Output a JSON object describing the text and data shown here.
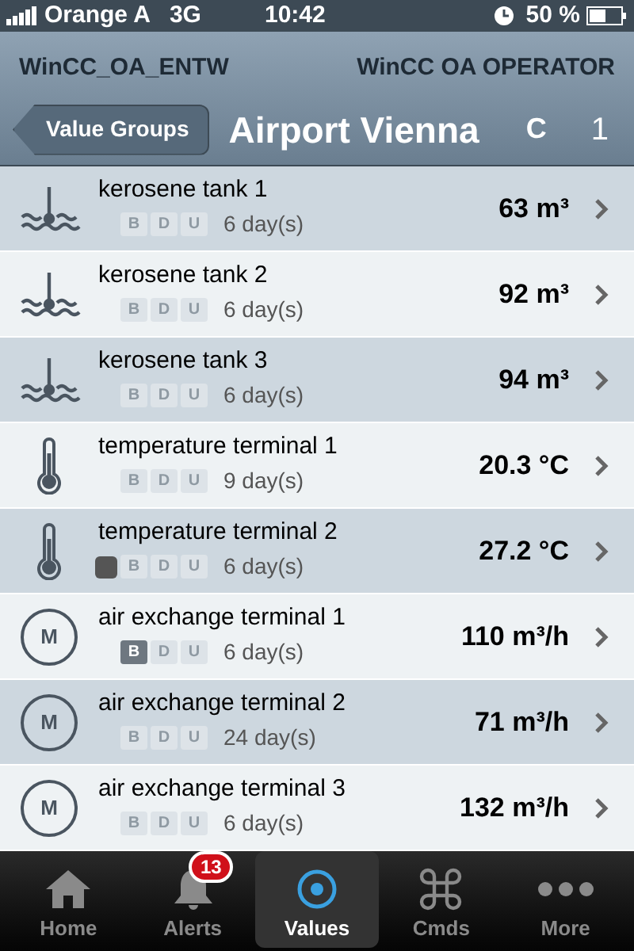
{
  "status_bar": {
    "carrier": "Orange A",
    "network": "3G",
    "time": "10:42",
    "battery": "50 %"
  },
  "header": {
    "system": "WinCC_OA_ENTW",
    "user": "WinCC OA OPERATOR",
    "back_button": "Value Groups",
    "title": "Airport Vienna",
    "refresh": "C",
    "count": "1"
  },
  "rows": [
    {
      "kind": "tank",
      "name": "kerosene tank 1",
      "alarm": false,
      "flags": [
        {
          "label": "B",
          "on": false
        },
        {
          "label": "D",
          "on": false
        },
        {
          "label": "U",
          "on": false
        }
      ],
      "age": "6 day(s)",
      "value": "63 m³"
    },
    {
      "kind": "tank",
      "name": "kerosene tank 2",
      "alarm": false,
      "flags": [
        {
          "label": "B",
          "on": false
        },
        {
          "label": "D",
          "on": false
        },
        {
          "label": "U",
          "on": false
        }
      ],
      "age": "6 day(s)",
      "value": "92 m³"
    },
    {
      "kind": "tank",
      "name": "kerosene tank 3",
      "alarm": false,
      "flags": [
        {
          "label": "B",
          "on": false
        },
        {
          "label": "D",
          "on": false
        },
        {
          "label": "U",
          "on": false
        }
      ],
      "age": "6 day(s)",
      "value": "94 m³"
    },
    {
      "kind": "thermometer",
      "name": "temperature terminal 1",
      "alarm": false,
      "flags": [
        {
          "label": "B",
          "on": false
        },
        {
          "label": "D",
          "on": false
        },
        {
          "label": "U",
          "on": false
        }
      ],
      "age": "9 day(s)",
      "value": "20.3 °C"
    },
    {
      "kind": "thermometer",
      "name": "temperature terminal 2",
      "alarm": true,
      "flags": [
        {
          "label": "B",
          "on": false
        },
        {
          "label": "D",
          "on": false
        },
        {
          "label": "U",
          "on": false
        }
      ],
      "age": "6 day(s)",
      "value": "27.2 °C"
    },
    {
      "kind": "motor",
      "icon_letter": "M",
      "name": "air exchange terminal 1",
      "alarm": false,
      "flags": [
        {
          "label": "B",
          "on": true
        },
        {
          "label": "D",
          "on": false
        },
        {
          "label": "U",
          "on": false
        }
      ],
      "age": "6 day(s)",
      "value": "110 m³/h"
    },
    {
      "kind": "motor",
      "icon_letter": "M",
      "name": "air exchange terminal 2",
      "alarm": false,
      "flags": [
        {
          "label": "B",
          "on": false
        },
        {
          "label": "D",
          "on": false
        },
        {
          "label": "U",
          "on": false
        }
      ],
      "age": "24 day(s)",
      "value": "71 m³/h"
    },
    {
      "kind": "motor",
      "icon_letter": "M",
      "name": "air exchange terminal 3",
      "alarm": false,
      "flags": [
        {
          "label": "B",
          "on": false
        },
        {
          "label": "D",
          "on": false
        },
        {
          "label": "U",
          "on": false
        }
      ],
      "age": "6 day(s)",
      "value": "132 m³/h"
    }
  ],
  "tab_bar": [
    {
      "kind": "home",
      "label": "Home",
      "selected": false
    },
    {
      "kind": "bell",
      "label": "Alerts",
      "badge": "13",
      "selected": false
    },
    {
      "kind": "target",
      "label": "Values",
      "selected": true
    },
    {
      "kind": "command",
      "label": "Cmds",
      "selected": false
    },
    {
      "kind": "dots",
      "label": "More",
      "selected": false
    }
  ]
}
